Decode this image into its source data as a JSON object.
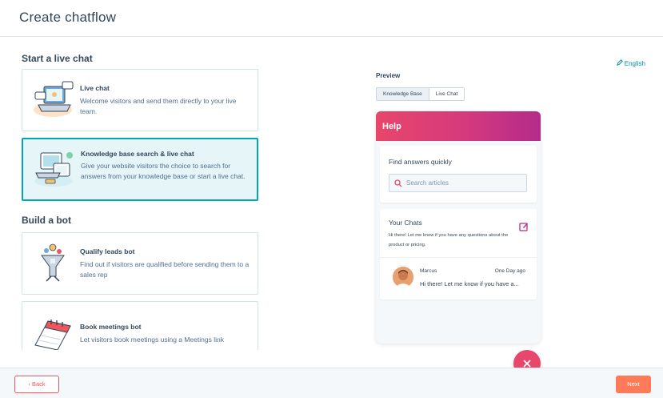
{
  "header": {
    "title": "Create chatflow"
  },
  "sections": {
    "live_chat": {
      "title": "Start a live chat",
      "cards": [
        {
          "title": "Live chat",
          "description": "Welcome visitors and send them directly to your live team.",
          "illustration": "laptop-chat-icon"
        },
        {
          "title": "Knowledge base search & live chat",
          "description": "Give your website visitors the choice to search for answers from your knowledge base or start a live chat.",
          "illustration": "knowledge-base-icon",
          "selected": true
        }
      ]
    },
    "bot": {
      "title": "Build a bot",
      "cards": [
        {
          "title": "Qualify leads bot",
          "description": "Find out if visitors are qualified before sending them to a sales rep",
          "illustration": "funnel-icon"
        },
        {
          "title": "Book meetings bot",
          "description": "Let visitors book meetings using a Meetings link",
          "illustration": "calendar-icon"
        }
      ]
    }
  },
  "language": {
    "label": "English",
    "icon": "pencil-icon"
  },
  "preview": {
    "label": "Preview",
    "tabs": [
      {
        "label": "Knowledge Base",
        "active": true
      },
      {
        "label": "Live Chat",
        "active": false
      }
    ],
    "widget": {
      "header": "Help",
      "find_title": "Find answers quickly",
      "search_placeholder": "Search articles",
      "chats_title": "Your Chats",
      "chats_message": "Hi there! Let me know if you have any questions about the product or pricing.",
      "chat_item": {
        "name": "Marcus",
        "time": "One Day ago",
        "message": "Hi there! Let me know if you have a..."
      }
    }
  },
  "footer": {
    "back_label": "‹ Back",
    "next_label": "Next"
  },
  "colors": {
    "accent": "#00a4bd",
    "brand": "#ff7a59",
    "widget_gradient_start": "#e8466b",
    "widget_gradient_end": "#b42b8a"
  }
}
